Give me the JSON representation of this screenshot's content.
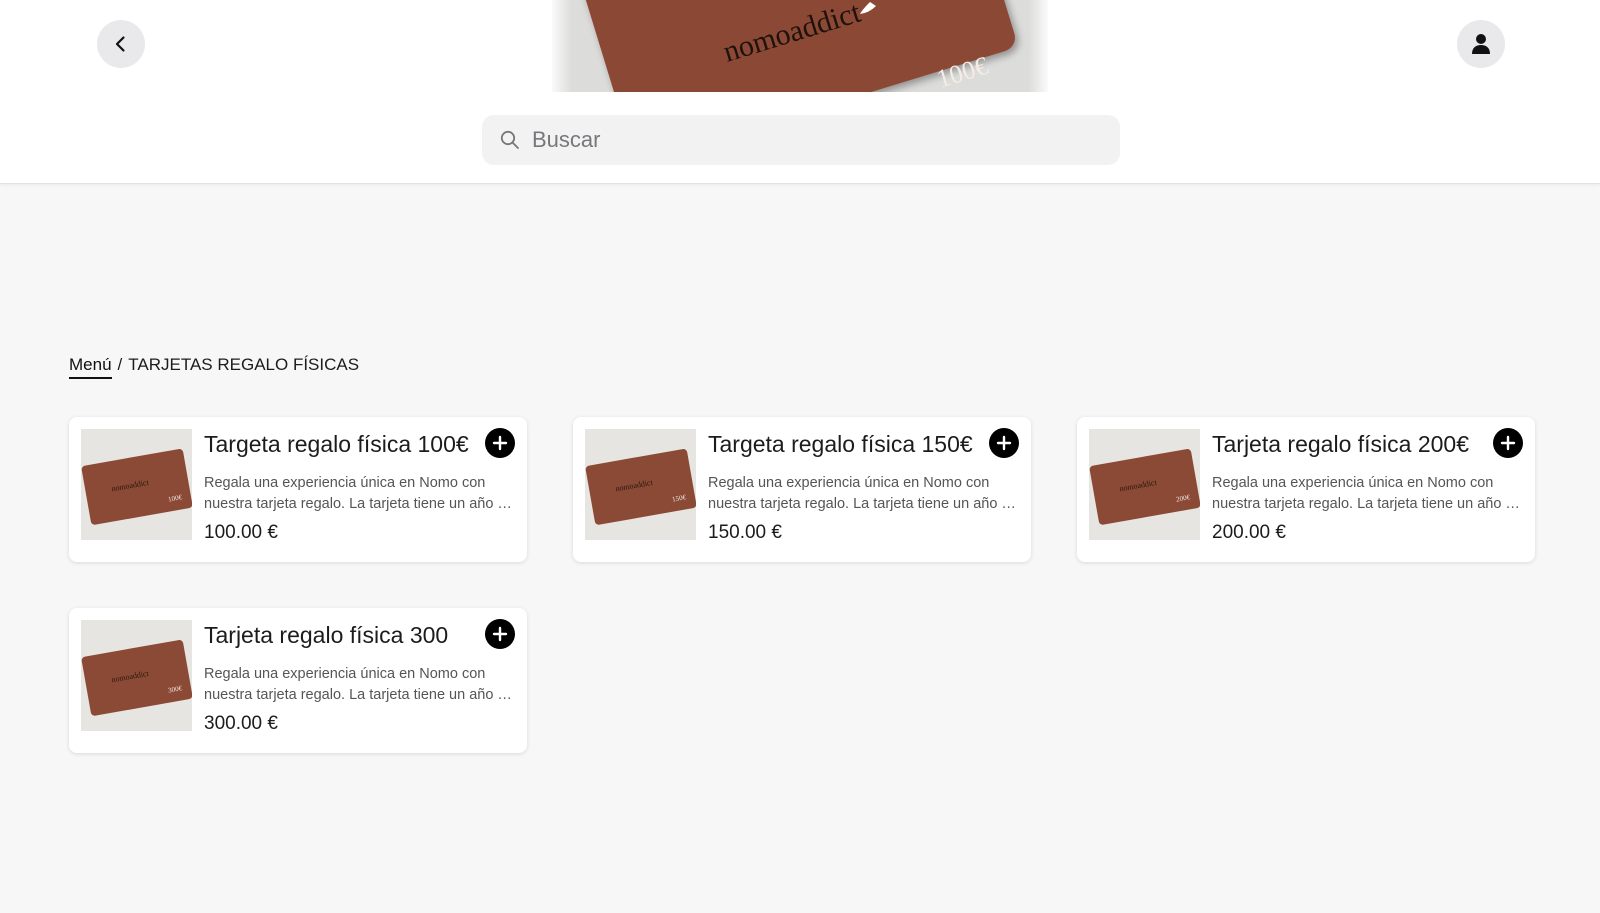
{
  "header": {
    "hero_brand": "nomoaddict",
    "hero_amount": "100€"
  },
  "search": {
    "placeholder": "Buscar"
  },
  "breadcrumb": {
    "root": "Menú",
    "separator": "/",
    "current": "TARJETAS REGALO FÍSICAS"
  },
  "products": [
    {
      "title": "Targeta regalo física 100€",
      "description": "Regala una experiencia única en Nomo con nuestra tarjeta regalo. La tarjeta tiene un año de validez.",
      "price": "100.00 €",
      "card_amount": "100€"
    },
    {
      "title": "Targeta regalo física 150€",
      "description": "Regala una experiencia única en Nomo con nuestra tarjeta regalo. La tarjeta tiene un año de validez.",
      "price": "150.00 €",
      "card_amount": "150€"
    },
    {
      "title": "Tarjeta regalo física 200€",
      "description": "Regala una experiencia única en Nomo con nuestra tarjeta regalo. La tarjeta tiene un año de validez.",
      "price": "200.00 €",
      "card_amount": "200€"
    },
    {
      "title": "Tarjeta regalo física 300",
      "description": "Regala una experiencia única en Nomo con nuestra tarjeta regalo. La tarjeta tiene un año de validez.",
      "price": "300.00 €",
      "card_amount": "300€"
    }
  ],
  "colors": {
    "card_brown": "#8b4a35",
    "page_bg": "#f7f7f7",
    "add_button": "#000000"
  },
  "icons": {
    "back": "chevron-left-icon",
    "profile": "user-icon",
    "search": "search-icon",
    "add": "plus-icon"
  }
}
